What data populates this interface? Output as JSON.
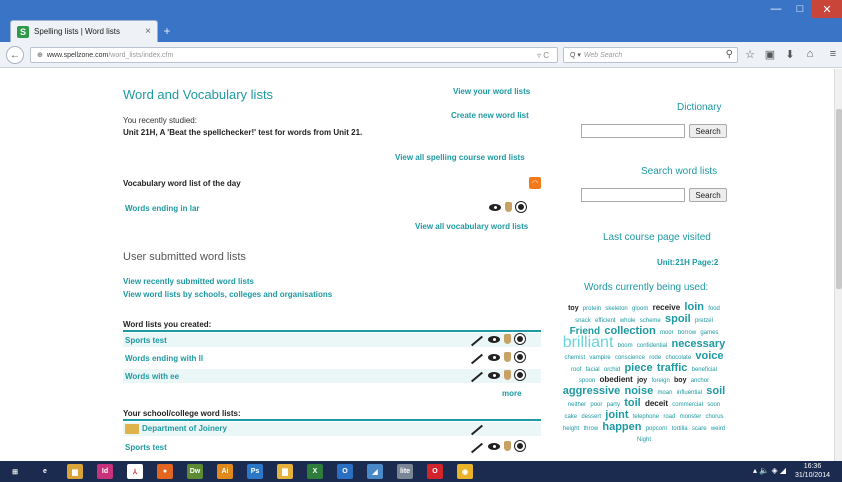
{
  "browser": {
    "tab_title": "Spelling lists | Word lists",
    "tab_close": "×",
    "new_tab": "+",
    "url_domain": "www.spellzone.com",
    "url_path": "/word_lists/index.cfm",
    "url_controls": "▿ C",
    "search_placeholder": "Web Search",
    "search_prefix": "Q ▾"
  },
  "page": {
    "main_title": "Word and Vocabulary lists",
    "view_your_lists": "View your word lists",
    "create_new": "Create new word list",
    "recently_studied_label": "You recently studied:",
    "recently_studied_value": "Unit 21H, A 'Beat the spellchecker!' test for words from Unit 21.",
    "view_all_spelling": "View all spelling course word lists",
    "vocab_of_day": "Vocabulary word list of the day",
    "words_ending_lar": "Words ending in lar",
    "view_all_vocab": "View all vocabulary word lists",
    "user_submitted": "User submitted word lists",
    "view_recent": "View recently submitted word lists",
    "view_schools": "View word lists by schools, colleges and organisations",
    "created_header": "Word lists you created:",
    "created_lists": [
      "Sports test",
      "Words ending with ll",
      "Words with ee"
    ],
    "more": "more",
    "school_header": "Your school/college word lists:",
    "school_folder": "Department of Joinery",
    "school_lists": [
      "Sports test"
    ]
  },
  "sidebar": {
    "dictionary": "Dictionary",
    "search_button": "Search",
    "search_word_lists": "Search word lists",
    "last_course": "Last course page visited",
    "last_course_value": "Unit:21H Page:2",
    "words_used": "Words currently being used:"
  },
  "cloud": [
    {
      "w": "toy",
      "s": 7,
      "b": true,
      "c": "#222"
    },
    {
      "w": "protein",
      "s": 6,
      "c": "#1e9aa2"
    },
    {
      "w": "skeleton",
      "s": 6,
      "c": "#1e9aa2"
    },
    {
      "w": "gloom",
      "s": 6,
      "c": "#1e9aa2"
    },
    {
      "w": "receive",
      "s": 8,
      "b": true,
      "c": "#222"
    },
    {
      "w": "loin",
      "s": 11,
      "b": true,
      "c": "#1e9aa2"
    },
    {
      "w": "food",
      "s": 6,
      "c": "#1e9aa2"
    },
    {
      "w": "snack",
      "s": 6,
      "c": "#1e9aa2"
    },
    {
      "w": "efficient",
      "s": 6,
      "c": "#1e9aa2"
    },
    {
      "w": "whole",
      "s": 6,
      "c": "#1e9aa2"
    },
    {
      "w": "scheme",
      "s": 6,
      "c": "#1e9aa2"
    },
    {
      "w": "spoil",
      "s": 11,
      "b": true,
      "c": "#1e9aa2"
    },
    {
      "w": "pretzel",
      "s": 6,
      "c": "#1e9aa2"
    },
    {
      "w": "Friend",
      "s": 10,
      "b": true,
      "c": "#1e9aa2"
    },
    {
      "w": "collection",
      "s": 11,
      "b": true,
      "c": "#1e9aa2"
    },
    {
      "w": "moor",
      "s": 6,
      "c": "#1e9aa2"
    },
    {
      "w": "borrow",
      "s": 6,
      "c": "#1e9aa2"
    },
    {
      "w": "games",
      "s": 6,
      "c": "#1e9aa2"
    },
    {
      "w": "brilliant",
      "s": 16,
      "c": "#6ad3dc"
    },
    {
      "w": "boom",
      "s": 6,
      "c": "#1e9aa2"
    },
    {
      "w": "confidential",
      "s": 6,
      "c": "#1e9aa2"
    },
    {
      "w": "necessary",
      "s": 11,
      "b": true,
      "c": "#1e9aa2"
    },
    {
      "w": "chemist",
      "s": 6,
      "c": "#1e9aa2"
    },
    {
      "w": "vampire",
      "s": 6,
      "c": "#1e9aa2"
    },
    {
      "w": "conscience",
      "s": 6,
      "c": "#1e9aa2"
    },
    {
      "w": "rode",
      "s": 6,
      "c": "#1e9aa2"
    },
    {
      "w": "chocolate",
      "s": 6,
      "c": "#1e9aa2"
    },
    {
      "w": "voice",
      "s": 11,
      "b": true,
      "c": "#1e9aa2"
    },
    {
      "w": "roof",
      "s": 6,
      "c": "#1e9aa2"
    },
    {
      "w": "facial",
      "s": 6,
      "c": "#1e9aa2"
    },
    {
      "w": "orchid",
      "s": 6,
      "c": "#1e9aa2"
    },
    {
      "w": "piece",
      "s": 11,
      "b": true,
      "c": "#1e9aa2"
    },
    {
      "w": "traffic",
      "s": 11,
      "b": true,
      "c": "#1e9aa2"
    },
    {
      "w": "beneficial",
      "s": 6,
      "c": "#1e9aa2"
    },
    {
      "w": "spoon",
      "s": 6,
      "c": "#1e9aa2"
    },
    {
      "w": "obedient",
      "s": 8,
      "b": true,
      "c": "#222"
    },
    {
      "w": "joy",
      "s": 7,
      "b": true,
      "c": "#222"
    },
    {
      "w": "foreign",
      "s": 6,
      "c": "#1e9aa2"
    },
    {
      "w": "boy",
      "s": 7,
      "b": true,
      "c": "#222"
    },
    {
      "w": "anchor",
      "s": 6,
      "c": "#1e9aa2"
    },
    {
      "w": "aggressive",
      "s": 11,
      "b": true,
      "c": "#1e9aa2"
    },
    {
      "w": "noise",
      "s": 11,
      "b": true,
      "c": "#1e9aa2"
    },
    {
      "w": "moan",
      "s": 6,
      "c": "#1e9aa2"
    },
    {
      "w": "influential",
      "s": 6,
      "c": "#1e9aa2"
    },
    {
      "w": "soil",
      "s": 11,
      "b": true,
      "c": "#1e9aa2"
    },
    {
      "w": "neither",
      "s": 6,
      "c": "#1e9aa2"
    },
    {
      "w": "poor",
      "s": 6,
      "c": "#1e9aa2"
    },
    {
      "w": "party",
      "s": 6,
      "c": "#1e9aa2"
    },
    {
      "w": "toil",
      "s": 11,
      "b": true,
      "c": "#1e9aa2"
    },
    {
      "w": "deceit",
      "s": 8,
      "b": true,
      "c": "#222"
    },
    {
      "w": "commercial",
      "s": 6,
      "c": "#1e9aa2"
    },
    {
      "w": "soon",
      "s": 6,
      "c": "#1e9aa2"
    },
    {
      "w": "cake",
      "s": 6,
      "c": "#1e9aa2"
    },
    {
      "w": "dessert",
      "s": 6,
      "c": "#1e9aa2"
    },
    {
      "w": "joint",
      "s": 11,
      "b": true,
      "c": "#1e9aa2"
    },
    {
      "w": "telephone",
      "s": 6,
      "c": "#1e9aa2"
    },
    {
      "w": "road",
      "s": 6,
      "c": "#1e9aa2"
    },
    {
      "w": "monster",
      "s": 6,
      "c": "#1e9aa2"
    },
    {
      "w": "chorus",
      "s": 6,
      "c": "#1e9aa2"
    },
    {
      "w": "height",
      "s": 6,
      "c": "#1e9aa2"
    },
    {
      "w": "throw",
      "s": 6,
      "c": "#1e9aa2"
    },
    {
      "w": "happen",
      "s": 11,
      "b": true,
      "c": "#1e9aa2"
    },
    {
      "w": "popcorn",
      "s": 6,
      "c": "#1e9aa2"
    },
    {
      "w": "tortilla",
      "s": 6,
      "c": "#1e9aa2"
    },
    {
      "w": "scare",
      "s": 6,
      "c": "#1e9aa2"
    },
    {
      "w": "weird",
      "s": 6,
      "c": "#1e9aa2"
    },
    {
      "w": "Night",
      "s": 6,
      "c": "#1e9aa2"
    }
  ],
  "taskbar": {
    "apps": [
      {
        "name": "start",
        "label": "⊞",
        "bg": "#1b2a4f"
      },
      {
        "name": "ie",
        "label": "e",
        "bg": "#1b2a4f"
      },
      {
        "name": "explorer",
        "label": "▆",
        "bg": "#d9a53a"
      },
      {
        "name": "indesign",
        "label": "Id",
        "bg": "#c7327a"
      },
      {
        "name": "acrobat",
        "label": "⅄",
        "bg": "#ffffff"
      },
      {
        "name": "firefox",
        "label": "●",
        "bg": "#e2661f"
      },
      {
        "name": "dreamweaver",
        "label": "Dw",
        "bg": "#5d8a33"
      },
      {
        "name": "illustrator",
        "label": "Ai",
        "bg": "#e08a1e"
      },
      {
        "name": "photoshop",
        "label": "Ps",
        "bg": "#2c78c8"
      },
      {
        "name": "folder",
        "label": "▇",
        "bg": "#e6b23e"
      },
      {
        "name": "excel",
        "label": "X",
        "bg": "#2e7d3d"
      },
      {
        "name": "outlook",
        "label": "O",
        "bg": "#2a6fc2"
      },
      {
        "name": "publisher",
        "label": "◢",
        "bg": "#4a89c8"
      },
      {
        "name": "app-lite",
        "label": "lite",
        "bg": "#7a8696"
      },
      {
        "name": "opera",
        "label": "O",
        "bg": "#d1242d"
      },
      {
        "name": "chrome",
        "label": "◉",
        "bg": "#e9b32a"
      }
    ],
    "tray": "▴ 🔈 ◈ ◢",
    "time": "16:36",
    "date": "31/10/2014"
  },
  "colors": {
    "accent": "#1e9aa2",
    "titlebar": "#3a74c6",
    "taskbar": "#1b2a4f"
  }
}
